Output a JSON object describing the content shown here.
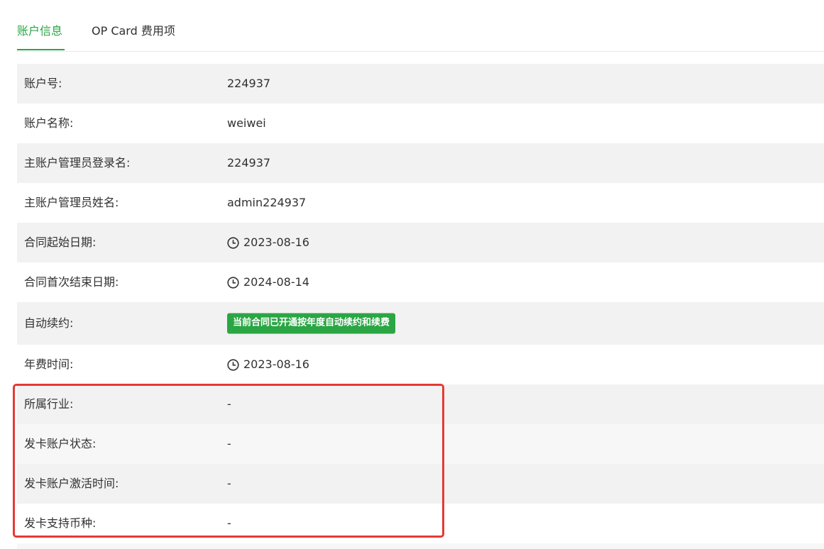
{
  "tabs": [
    {
      "label": "账户信息",
      "active": true
    },
    {
      "label": "OP Card 费用项",
      "active": false
    }
  ],
  "accent_color": "#2aa644",
  "highlight_color": "#e53935",
  "rows": [
    {
      "label": "账户号:",
      "value": "224937"
    },
    {
      "label": "账户名称:",
      "value": "weiwei"
    },
    {
      "label": "主账户管理员登录名:",
      "value": "224937"
    },
    {
      "label": "主账户管理员姓名:",
      "value": "admin224937"
    },
    {
      "label": "合同起始日期:",
      "value": "2023-08-16",
      "icon": "clock-icon"
    },
    {
      "label": "合同首次结束日期:",
      "value": "2024-08-14",
      "icon": "clock-icon"
    },
    {
      "label": "自动续约:",
      "badge": "当前合同已开通按年度自动续约和续费"
    },
    {
      "label": "年费时间:",
      "value": "2023-08-16",
      "icon": "clock-icon"
    },
    {
      "label": "所属行业:",
      "value": "-"
    },
    {
      "label": "发卡账户状态:",
      "value": "-"
    },
    {
      "label": "发卡账户激活时间:",
      "value": "-"
    },
    {
      "label": "发卡支持币种:",
      "value": "-"
    }
  ]
}
